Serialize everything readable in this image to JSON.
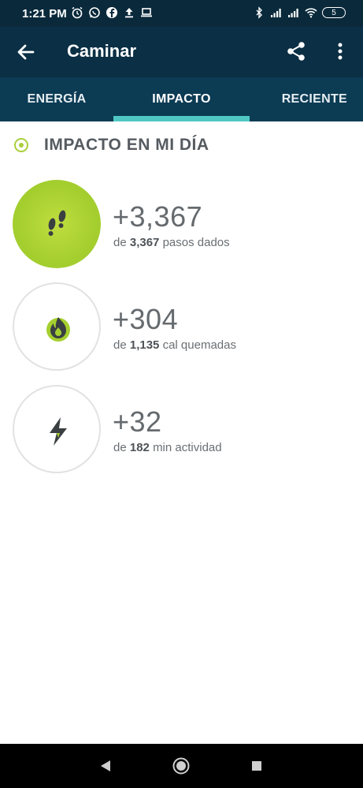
{
  "status": {
    "time": "1:21 PM",
    "battery": "5",
    "left_icons": [
      "alarm-icon",
      "whatsapp-icon",
      "facebook-icon",
      "upload-icon",
      "laptop-icon"
    ],
    "right_icons": [
      "bluetooth-icon",
      "signal-icon",
      "signal-icon",
      "wifi-icon",
      "battery-icon"
    ]
  },
  "appbar": {
    "title": "Caminar",
    "back_icon": "arrow-left-icon",
    "share_icon": "share-icon",
    "more_icon": "more-vert-icon"
  },
  "tabs": [
    {
      "label": "ENERGÍA",
      "active": false
    },
    {
      "label": "IMPACTO",
      "active": true
    },
    {
      "label": "RECIENTE",
      "active": false
    }
  ],
  "section": {
    "title": "IMPACTO EN MI DÍA"
  },
  "metrics": [
    {
      "value": "+3,367",
      "prefix": "de",
      "total": "3,367",
      "unit": "pasos dados",
      "icon": "footprints-icon"
    },
    {
      "value": "+304",
      "prefix": "de",
      "total": "1,135",
      "unit": "cal quemadas",
      "icon": "flame-icon"
    },
    {
      "value": "+32",
      "prefix": "de",
      "total": "182",
      "unit": "min actividad",
      "icon": "lightning-icon"
    }
  ],
  "colors": {
    "appbar": "#0b2f44",
    "tabs": "#0c3b54",
    "accent_teal": "#4fc8c4",
    "accent_green": "#a5cf2f",
    "text_gray": "#656a6e"
  },
  "nav": [
    "back-triangle-icon",
    "home-circle-icon",
    "recents-square-icon"
  ]
}
